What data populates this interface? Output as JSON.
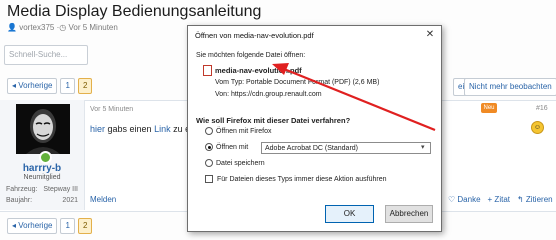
{
  "thread": {
    "title": "Media Display Bedienungsanleitung",
    "author": "vortex375",
    "time": "Vor 5 Minuten"
  },
  "search": {
    "placeholder": "Schnell-Suche..."
  },
  "pager": {
    "prev_label": "◂ Vorherige",
    "pages": [
      "1",
      "2"
    ],
    "current": "2"
  },
  "toolbar": {
    "reply_label": "eitrag",
    "unwatch_label": "Nicht mehr beobachten"
  },
  "post": {
    "time": "Vor 5 Minuten",
    "badge": "Neu",
    "number": "#16",
    "body_before": " gabs einen ",
    "link_first": "hier",
    "link_second": "Link",
    "body_after": " zu eine",
    "report_label": "Melden",
    "actions": [
      "Danke",
      "+ Zitat",
      "Zitieren"
    ]
  },
  "user": {
    "name": "harrry-b",
    "title": "Neumitglied",
    "fields": [
      {
        "label": "Fahrzeug:",
        "value": "Stepway III"
      },
      {
        "label": "Baujahr:",
        "value": "2021"
      }
    ]
  },
  "dialog": {
    "title": "Öffnen von media-nav-evolution.pdf",
    "intro": "Sie möchten folgende Datei öffnen:",
    "file_name": "media-nav-evolution.pdf",
    "file_type": "Vom Typ: Portable Document Format (PDF) (2,6 MB)",
    "file_source": "Von: https://cdn.group.renault.com",
    "question": "Wie soll Firefox mit dieser Datei verfahren?",
    "options": [
      "Öffnen mit Firefox",
      "Öffnen mit",
      "Datei speichern"
    ],
    "selected_option": "Öffnen mit",
    "app": "Adobe Acrobat DC (Standard)",
    "always_label": "Für Dateien dieses Typs immer diese Aktion ausführen",
    "always_checked": false,
    "ok_label": "OK",
    "cancel_label": "Abbrechen",
    "close_symbol": "✕"
  },
  "colors": {
    "accent": "#2a64a8",
    "annotation_arrow": "#e02020",
    "current_page": "#fdf0cc"
  }
}
